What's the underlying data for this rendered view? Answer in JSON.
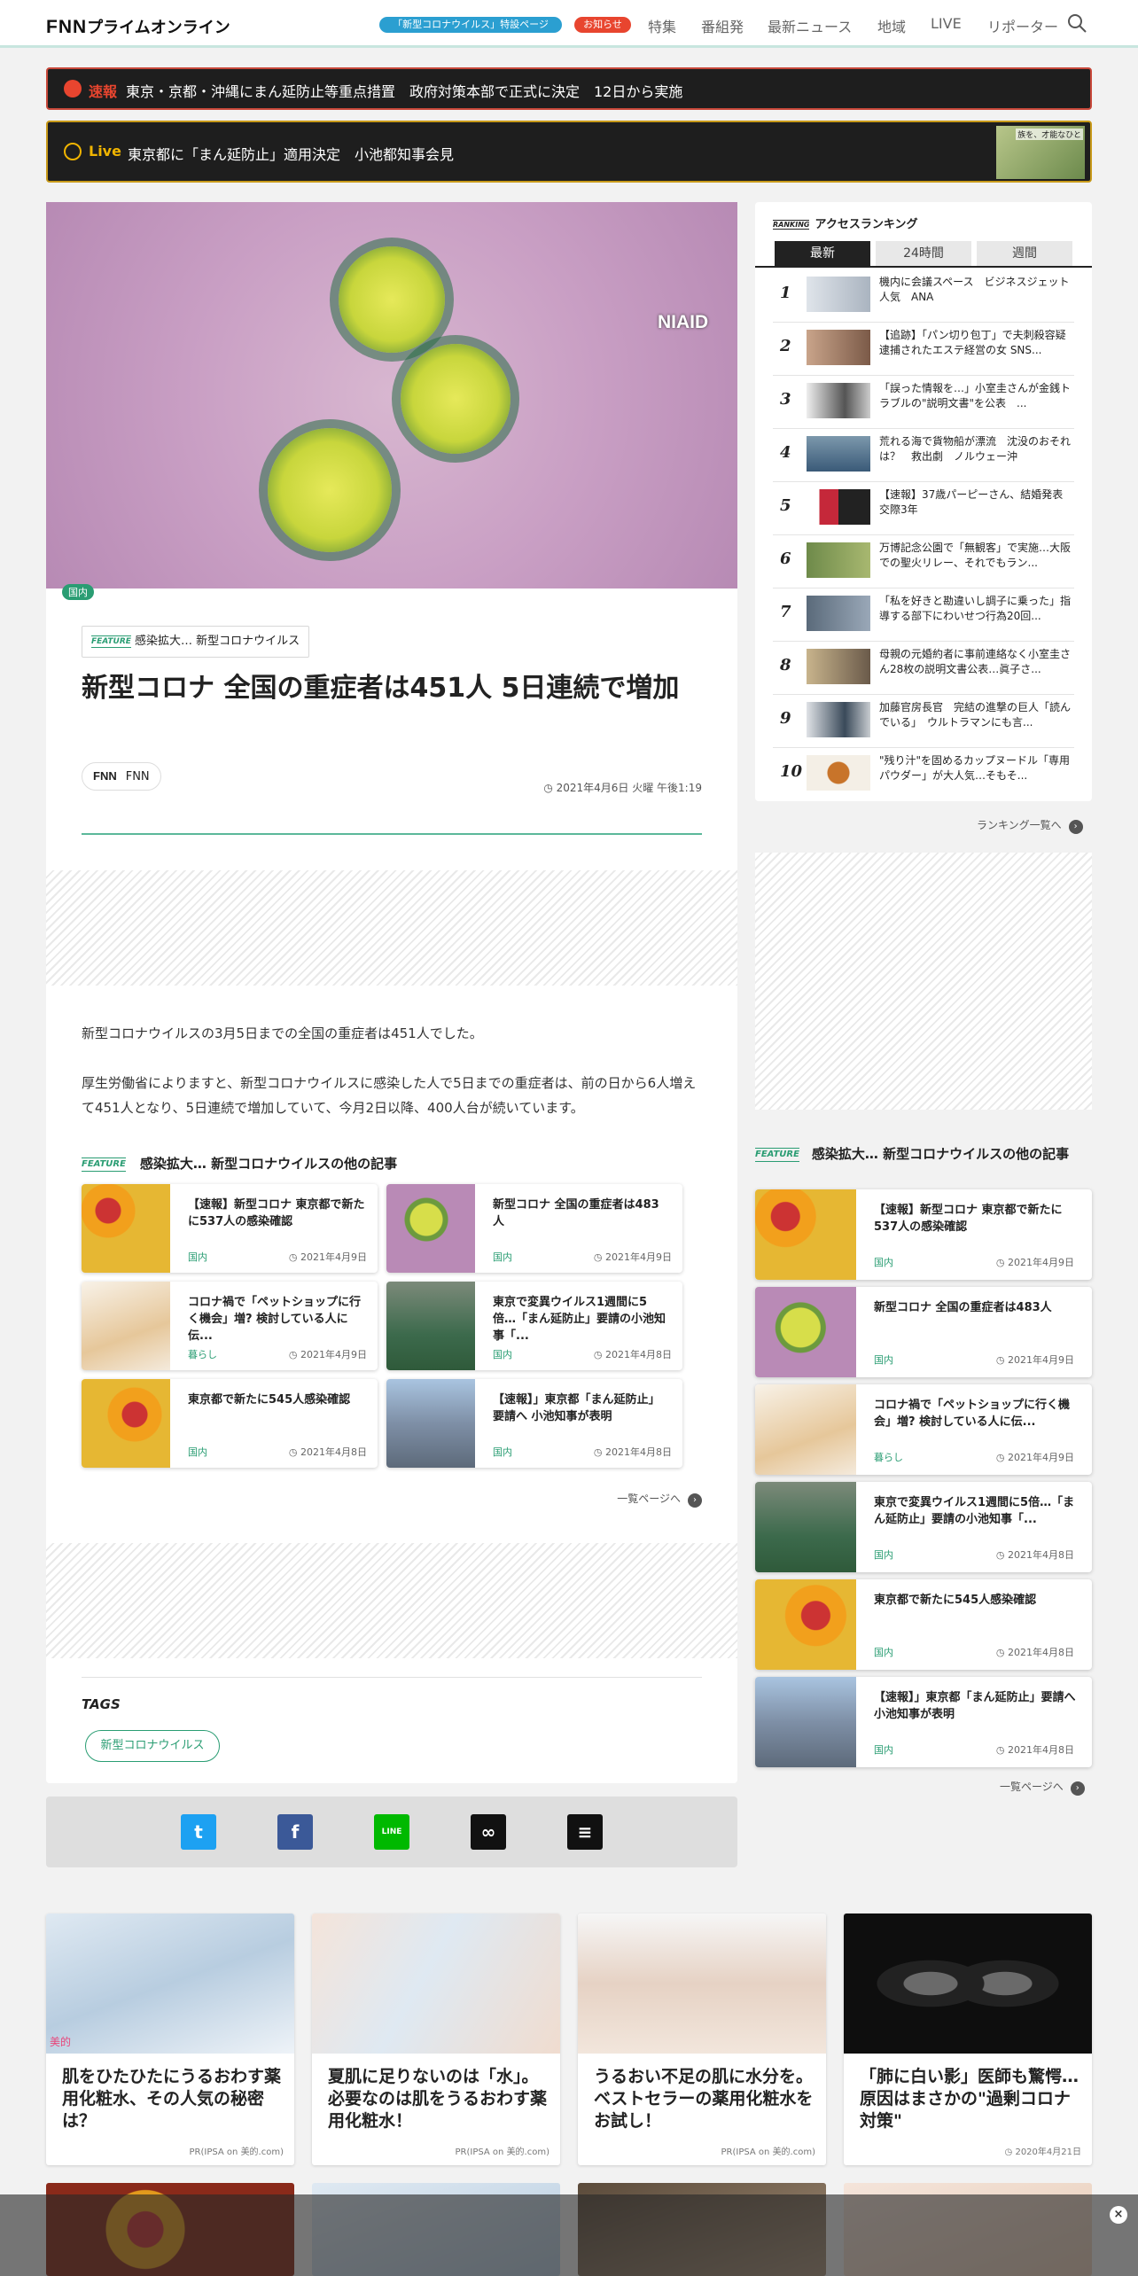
{
  "header": {
    "logo_fnn": "FNN",
    "logo_text": "プライムオンライン",
    "special_page": "「新型コロナウイルス」特設ページ",
    "notice": "お知らせ",
    "nav": [
      "特集",
      "番組発",
      "最新ニュース",
      "地域",
      "LIVE",
      "リポーター"
    ]
  },
  "breaking": {
    "label": "速報",
    "text": "東京・京都・沖縄にまん延防止等重点措置　政府対策本部で正式に決定　12日から実施"
  },
  "live": {
    "label": "Live",
    "text": "東京都に「まん延防止」適用決定　小池都知事会見",
    "thumb_caption": "族を、才能なひと"
  },
  "article": {
    "hero_credit": "NIAID",
    "category": "国内",
    "feature_label": "FEATURE",
    "feature_name": "感染拡大… 新型コロナウイルス",
    "title": "新型コロナ 全国の重症者は451人 5日連続で増加",
    "author_logo": "FNN",
    "author": "FNN",
    "date": "2021年4月6日 火曜 午後1:19",
    "para1": "新型コロナウイルスの3月5日までの全国の重症者は451人でした。",
    "para2": "厚生労働省によりますと、新型コロナウイルスに感染した人で5日までの重症者は、前の日から6人増えて451人となり、5日連続で増加していて、今月2日以降、400人台が続いています。",
    "related_title": "感染拡大… 新型コロナウイルスの他の記事",
    "related": [
      {
        "title": "【速報】新型コロナ 東京都で新たに537人の感染確認",
        "category": "国内",
        "date": "2021年4月9日"
      },
      {
        "title": "新型コロナ 全国の重症者は483人",
        "category": "国内",
        "date": "2021年4月9日"
      },
      {
        "title": "コロナ禍で「ペットショップに行く機会」増? 検討している人に伝...",
        "category": "暮らし",
        "date": "2021年4月9日"
      },
      {
        "title": "東京で変異ウイルス1週間に5倍…「まん延防止」要請の小池知事「...",
        "category": "国内",
        "date": "2021年4月8日"
      },
      {
        "title": "東京都で新たに545人感染確認",
        "category": "国内",
        "date": "2021年4月8日"
      },
      {
        "title": "【速報】」東京都「まん延防止」要請へ 小池知事が表明",
        "category": "国内",
        "date": "2021年4月8日"
      }
    ],
    "more_link": "一覧ページへ",
    "tags_title": "TAGS",
    "tag": "新型コロナウイルス"
  },
  "share": {
    "twitter": "t",
    "facebook": "f",
    "line": "LINE",
    "link": "∞",
    "comment": "≡"
  },
  "ranking": {
    "ranking_label": "RANKING",
    "title": "アクセスランキング",
    "tabs": [
      "最新",
      "24時間",
      "週間"
    ],
    "items": [
      {
        "rank": "1",
        "title": "機内に会議スペース　ビジネスジェット人気　ANA"
      },
      {
        "rank": "2",
        "title": "【追跡】「パン切り包丁」で夫刺殺容疑 逮捕されたエステ経営の女 SNS..."
      },
      {
        "rank": "3",
        "title": "「誤った情報を…」小室圭さんが金銭トラブルの\"説明文書\"を公表　..."
      },
      {
        "rank": "4",
        "title": "荒れる海で貨物船が漂流　沈没のおそれは？　救出劇　ノルウェー沖"
      },
      {
        "rank": "5",
        "title": "【速報】37歳パーピーさん、結婚発表　交際3年"
      },
      {
        "rank": "6",
        "title": "万博記念公園で「無観客」で実施…大阪での聖火リレー、それでもラン..."
      },
      {
        "rank": "7",
        "title": "「私を好きと勘違いし調子に乗った」指導する部下にわいせつ行為20回..."
      },
      {
        "rank": "8",
        "title": "母親の元婚約者に事前連絡なく小室圭さん28枚の説明文書公表…眞子さ..."
      },
      {
        "rank": "9",
        "title": "加藤官房長官　完結の進撃の巨人「読んでいる」　ウルトラマンにも言..."
      },
      {
        "rank": "10",
        "title": "\"残り汁\"を固めるカップヌードル「専用パウダー」が大人気…そもそ..."
      }
    ],
    "more": "ランキング一覧へ"
  },
  "side_feature": {
    "title": "感染拡大… 新型コロナウイルスの他の記事",
    "items": [
      {
        "title": "【速報】新型コロナ 東京都で新たに537人の感染確認",
        "category": "国内",
        "date": "2021年4月9日"
      },
      {
        "title": "新型コロナ 全国の重症者は483人",
        "category": "国内",
        "date": "2021年4月9日"
      },
      {
        "title": "コロナ禍で「ペットショップに行く機会」増? 検討している人に伝...",
        "category": "暮らし",
        "date": "2021年4月9日"
      },
      {
        "title": "東京で変異ウイルス1週間に5倍…「まん延防止」要請の小池知事「...",
        "category": "国内",
        "date": "2021年4月8日"
      },
      {
        "title": "東京都で新たに545人感染確認",
        "category": "国内",
        "date": "2021年4月8日"
      },
      {
        "title": "【速報】」東京都「まん延防止」要請へ 小池知事が表明",
        "category": "国内",
        "date": "2021年4月8日"
      }
    ],
    "more": "一覧ページへ"
  },
  "promos": [
    {
      "title": "肌をひたひたにうるおわす薬用化粧水、その人気の秘密は？",
      "source": "PR(IPSA on 美的.com)",
      "badge": "美的"
    },
    {
      "title": "夏肌に足りないのは「水」。必要なのは肌をうるおわす薬用化粧水！",
      "source": "PR(IPSA on 美的.com)"
    },
    {
      "title": "うるおい不足の肌に水分を。ベストセラーの薬用化粧水をお試し！",
      "source": "PR(IPSA on 美的.com)"
    },
    {
      "title": "「肺に白い影」医師も驚愕…原因はまさかの\"過剰コロナ対策\"",
      "source": "2020年4月21日"
    }
  ],
  "overlay": {
    "close": "×"
  },
  "colors": {
    "accent_green": "#2a9d73",
    "breaking_red": "#e8452f",
    "live_yellow": "#f0b400"
  }
}
